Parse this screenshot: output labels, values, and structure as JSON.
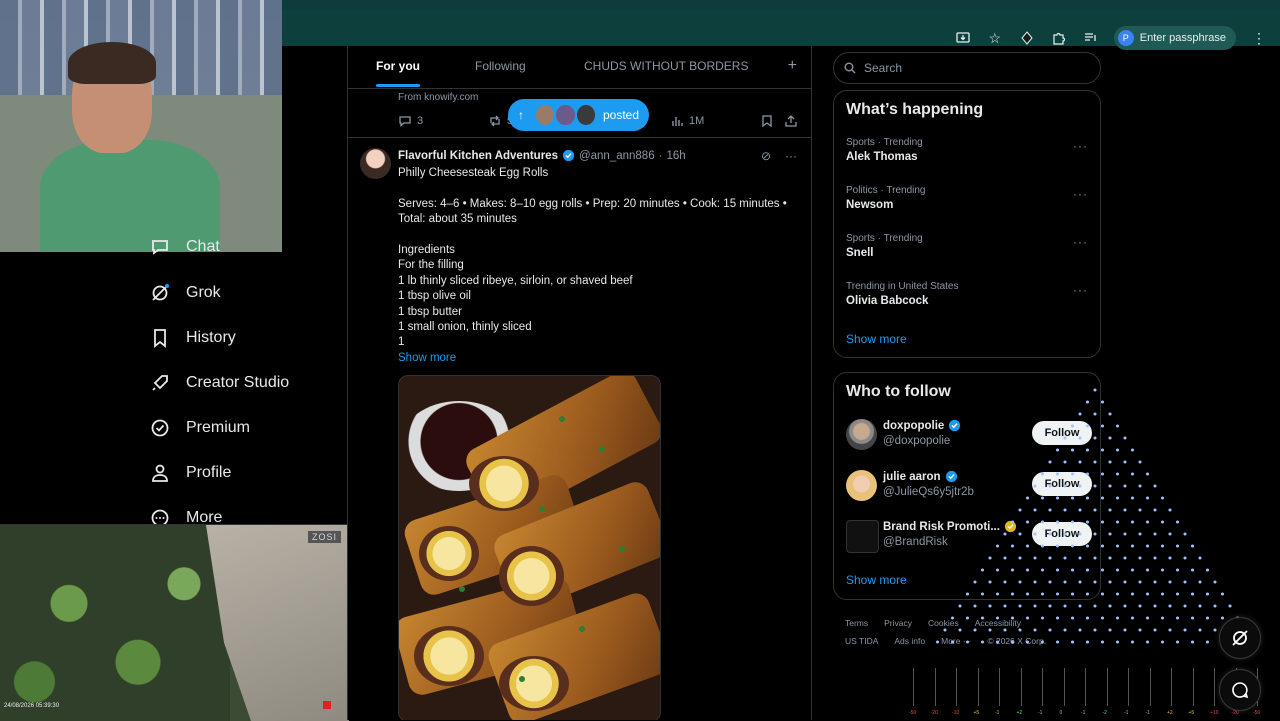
{
  "browser": {
    "passphrase_label": "Enter passphrase",
    "profile_initial": "P",
    "icons": [
      "install-icon",
      "star-icon",
      "extension-icon",
      "puzzle-icon",
      "media-icon",
      "menu-icon"
    ]
  },
  "sidebar": {
    "items": [
      {
        "label": "Chat",
        "icon": "chat-icon"
      },
      {
        "label": "Grok",
        "icon": "grok-icon"
      },
      {
        "label": "History",
        "icon": "bookmark-icon"
      },
      {
        "label": "Creator Studio",
        "icon": "rocket-icon"
      },
      {
        "label": "Premium",
        "icon": "verified-icon"
      },
      {
        "label": "Profile",
        "icon": "person-icon"
      },
      {
        "label": "More",
        "icon": "more-icon"
      }
    ]
  },
  "feed": {
    "tabs": [
      "For you",
      "Following",
      "CHUDS WITHOUT BORDERS"
    ],
    "prev_tweet": {
      "source": "From knowify.com",
      "replies": "3",
      "retweets": "5",
      "views": "1M"
    },
    "posted_label": "posted",
    "tweet": {
      "name": "Flavorful Kitchen Adventures",
      "handle": "@ann_ann886",
      "time": "16h",
      "lines": [
        "Philly Cheesesteak Egg Rolls",
        "",
        "Serves: 4–6 • Makes: 8–10 egg rolls • Prep: 20 minutes • Cook: 15 minutes •",
        "Total: about 35 minutes",
        "",
        "Ingredients",
        "For the filling",
        "1 lb thinly sliced ribeye, sirloin, or shaved beef",
        "1 tbsp olive oil",
        "1 tbsp butter",
        "1 small onion, thinly sliced",
        "1"
      ],
      "show_more": "Show more"
    }
  },
  "right": {
    "search_placeholder": "Search",
    "whats_happening": {
      "title": "What’s happening",
      "trends": [
        {
          "meta": "Sports · Trending",
          "name": "Alek Thomas"
        },
        {
          "meta": "Politics · Trending",
          "name": "Newsom"
        },
        {
          "meta": "Sports · Trending",
          "name": "Snell"
        },
        {
          "meta": "Trending in United States",
          "name": "Olivia Babcock"
        }
      ],
      "show_more": "Show more"
    },
    "who_to_follow": {
      "title": "Who to follow",
      "accounts": [
        {
          "name": "doxpopolie",
          "handle": "@doxpopolie",
          "badge": "#1d9bf0",
          "button": "Follow"
        },
        {
          "name": "julie aaron",
          "handle": "@JulieQs6y5jtr2b",
          "badge": "#1d9bf0",
          "button": "Follow"
        },
        {
          "name": "Brand Risk Promoti...",
          "handle": "@BrandRisk",
          "badge": "#e2b719",
          "button": "Follow"
        }
      ],
      "show_more": "Show more"
    },
    "footer": {
      "row1": [
        "Terms",
        "Privacy",
        "Cookies",
        "Accessibility"
      ],
      "row2": [
        "US TIDA",
        "Ads info",
        "More ···",
        "© 2026 X Corp."
      ]
    }
  },
  "overlays": {
    "cam_brand": "ZOSI",
    "cam_timestamp": "24/08/2026 05:39:30",
    "meter_labels": [
      "-50",
      "-20",
      "-10",
      "+5",
      "-1",
      "+2",
      "-1",
      "0",
      "-1",
      "-2",
      "-1",
      "-1",
      "+2",
      "+5",
      "+10",
      "-20",
      "-50"
    ]
  }
}
